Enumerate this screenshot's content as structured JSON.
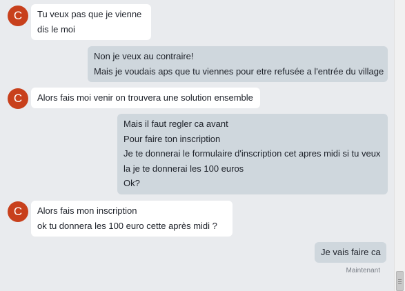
{
  "conversation": {
    "contact_initial": "C",
    "timestamp": "Maintenant",
    "messages": [
      {
        "direction": "in",
        "lines": [
          "Tu veux pas  que je vienne",
          "dis le moi"
        ]
      },
      {
        "direction": "out",
        "lines": [
          "Non je veux au contraire!",
          "Mais je voudais aps que tu viennes pour etre refusée a l'entrée du village"
        ]
      },
      {
        "direction": "in",
        "lines": [
          "Alors fais moi venir on trouvera une solution ensemble"
        ]
      },
      {
        "direction": "out",
        "lines": [
          "Mais il faut regler ca avant",
          "Pour faire ton inscription",
          "Je te donnerai le formulaire d'inscription cet apres midi si tu veux",
          "la je te donnerai les 100 euros",
          "Ok?"
        ]
      },
      {
        "direction": "in",
        "lines": [
          "Alors fais mon inscription",
          "ok  tu donnera les 100 euro cette après  midi ?"
        ]
      },
      {
        "direction": "out",
        "lines": [
          "Je vais faire ca"
        ]
      }
    ]
  }
}
